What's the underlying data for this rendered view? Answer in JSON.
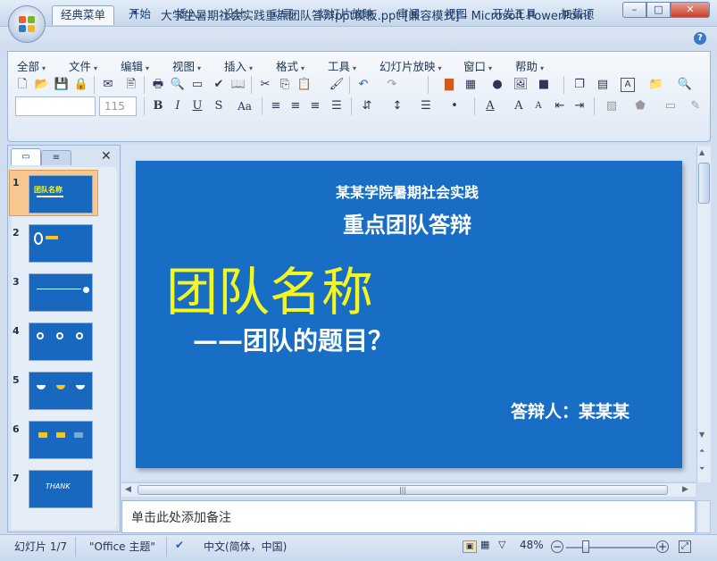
{
  "window": {
    "title": "大学生暑期社会实践重点团队答辩ppt模板.ppt [兼容模式] - Microsoft PowerPoint"
  },
  "tabs": [
    "经典菜单",
    "开始",
    "插入",
    "设计",
    "动画",
    "幻灯片放映",
    "审阅",
    "视图",
    "开发工具",
    "加载项"
  ],
  "classic_menu": [
    "全部",
    "文件",
    "编辑",
    "视图",
    "插入",
    "格式",
    "工具",
    "幻灯片放映",
    "窗口",
    "帮助"
  ],
  "font_size_value": "115",
  "slide": {
    "line1": "某某学院暑期社会实践",
    "line2": "重点团队答辩",
    "team_name": "团队名称",
    "subtitle": "——团队的题目？",
    "presenter": "答辩人：某某某",
    "background_color": "#186ec5",
    "team_name_color": "#f5f51f"
  },
  "thumbnails": [
    {
      "num": "1",
      "caption": "团队名称"
    },
    {
      "num": "2",
      "caption": ""
    },
    {
      "num": "3",
      "caption": ""
    },
    {
      "num": "4",
      "caption": ""
    },
    {
      "num": "5",
      "caption": ""
    },
    {
      "num": "6",
      "caption": ""
    },
    {
      "num": "7",
      "caption": "THANK"
    }
  ],
  "notes_placeholder": "单击此处添加备注",
  "status": {
    "slide_counter": "幻灯片 1/7",
    "theme": "\"Office 主题\"",
    "language": "中文(简体，中国)",
    "zoom": "48%"
  },
  "icons": [
    "office-button-icon",
    "save-icon",
    "undo-icon",
    "redo-icon",
    "minimize-icon",
    "maximize-icon",
    "close-icon",
    "help-icon"
  ]
}
